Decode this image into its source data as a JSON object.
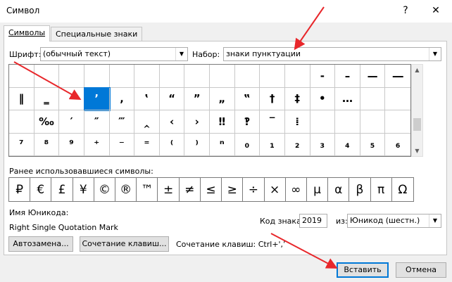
{
  "window": {
    "title": "Символ",
    "help_glyph": "?",
    "close_glyph": "✕"
  },
  "tabs": [
    {
      "label": "Символы"
    },
    {
      "label": "Специальные знаки"
    }
  ],
  "font": {
    "label": "Шрифт:",
    "value": "(обычный текст)"
  },
  "subset": {
    "label": "Набор:",
    "value": "знаки пунктуации"
  },
  "grid": {
    "rows": [
      [
        " ",
        " ",
        " ",
        " ",
        " ",
        " ",
        " ",
        " ",
        " ",
        " ",
        " ",
        " ",
        "‐",
        "–",
        "—",
        "―"
      ],
      [
        "‖",
        "‗",
        "‘",
        "’",
        "‚",
        "‛",
        "“",
        "”",
        "„",
        "‟",
        "†",
        "‡",
        "•",
        "…",
        " ",
        " "
      ],
      [
        " ",
        "‰",
        "′",
        "″",
        "‴",
        "‸",
        "‹",
        "›",
        "‼",
        "‽",
        "‾",
        "⁞",
        " ",
        " ",
        " ",
        " "
      ],
      [
        "⁷",
        "⁸",
        "⁹",
        "⁺",
        "⁻",
        "⁼",
        "⁽",
        "⁾",
        "ⁿ",
        "₀",
        "₁",
        "₂",
        "₃",
        "₄",
        "₅",
        "₆"
      ]
    ],
    "selected": "’"
  },
  "recent": {
    "label": "Ранее использовавшиеся символы:",
    "symbols": [
      "₽",
      "€",
      "£",
      "¥",
      "©",
      "®",
      "™",
      "±",
      "≠",
      "≤",
      "≥",
      "÷",
      "×",
      "∞",
      "µ",
      "α",
      "β",
      "π",
      "Ω"
    ]
  },
  "unicode": {
    "name_label": "Имя Юникода:",
    "name_value": "Right Single Quotation Mark",
    "code_label": "Код знака:",
    "code_value": "2019",
    "from_label": "из:",
    "from_value": "Юникод (шестн.)"
  },
  "buttons": {
    "autocorrect": "Автозамена...",
    "shortcut_key": "Сочетание клавиш...",
    "shortcut_text": "Сочетание клавиш: Ctrl+',’",
    "insert": "Вставить",
    "cancel": "Отмена"
  },
  "colors": {
    "accent": "#0078d7",
    "annotation_arrow": "#e8272b"
  }
}
